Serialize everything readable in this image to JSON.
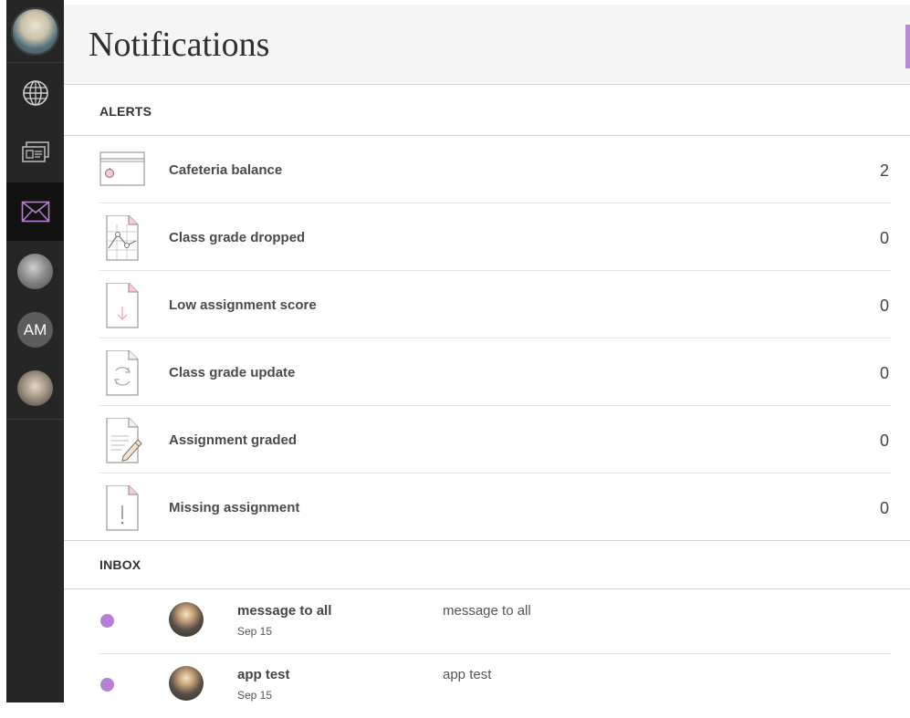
{
  "page": {
    "title": "Notifications"
  },
  "sidebar": {
    "items": [
      {
        "name": "profile",
        "icon": "profile-avatar"
      },
      {
        "name": "institution",
        "icon": "globe-icon"
      },
      {
        "name": "activity",
        "icon": "activity-stream-icon"
      },
      {
        "name": "messages",
        "icon": "envelope-icon",
        "active": true
      },
      {
        "name": "course-1",
        "icon": "course-avatar"
      },
      {
        "name": "course-2",
        "initials": "AM"
      },
      {
        "name": "course-3",
        "icon": "course-avatar"
      }
    ],
    "active_color": "#b97fd6"
  },
  "alerts": {
    "heading": "ALERTS",
    "items": [
      {
        "label": "Cafeteria balance",
        "count": "2",
        "icon": "cafeteria-card-icon"
      },
      {
        "label": "Class grade dropped",
        "count": "0",
        "icon": "grade-chart-icon"
      },
      {
        "label": "Low assignment score",
        "count": "0",
        "icon": "down-arrow-document-icon"
      },
      {
        "label": "Class grade update",
        "count": "0",
        "icon": "refresh-document-icon"
      },
      {
        "label": "Assignment graded",
        "count": "0",
        "icon": "pencil-document-icon"
      },
      {
        "label": "Missing assignment",
        "count": "0",
        "icon": "exclamation-document-icon"
      }
    ]
  },
  "inbox": {
    "heading": "INBOX",
    "messages": [
      {
        "subject": "message to all",
        "date": "Sep 15",
        "preview": "message to all",
        "unread": true
      },
      {
        "subject": "app test",
        "date": "Sep 15",
        "preview": "app test",
        "unread": true
      }
    ]
  },
  "colors": {
    "accent": "#b97fd6",
    "sidebar": "#262626",
    "header": "#f5f5f5"
  }
}
